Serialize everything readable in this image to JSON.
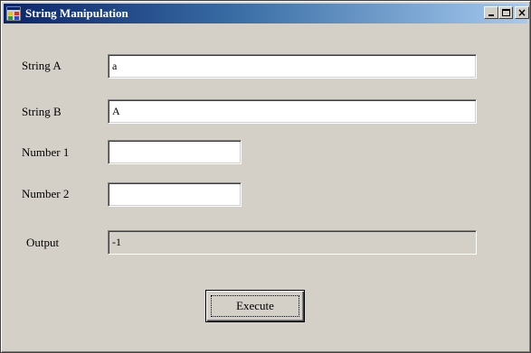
{
  "window": {
    "title": "String Manipulation",
    "icon": "app-form-icon",
    "controls": {
      "minimize": "minimize-icon",
      "maximize": "maximize-icon",
      "close": "×"
    }
  },
  "form": {
    "string_a": {
      "label": "String A",
      "value": "a"
    },
    "string_b": {
      "label": "String B",
      "value": "A"
    },
    "number1": {
      "label": "Number 1",
      "value": ""
    },
    "number2": {
      "label": "Number 2",
      "value": ""
    },
    "output": {
      "label": "Output",
      "value": "-1"
    }
  },
  "buttons": {
    "execute": "Execute"
  },
  "colors": {
    "face": "#d4d0c8",
    "title_start": "#0a246a",
    "title_end": "#a6caf0"
  }
}
